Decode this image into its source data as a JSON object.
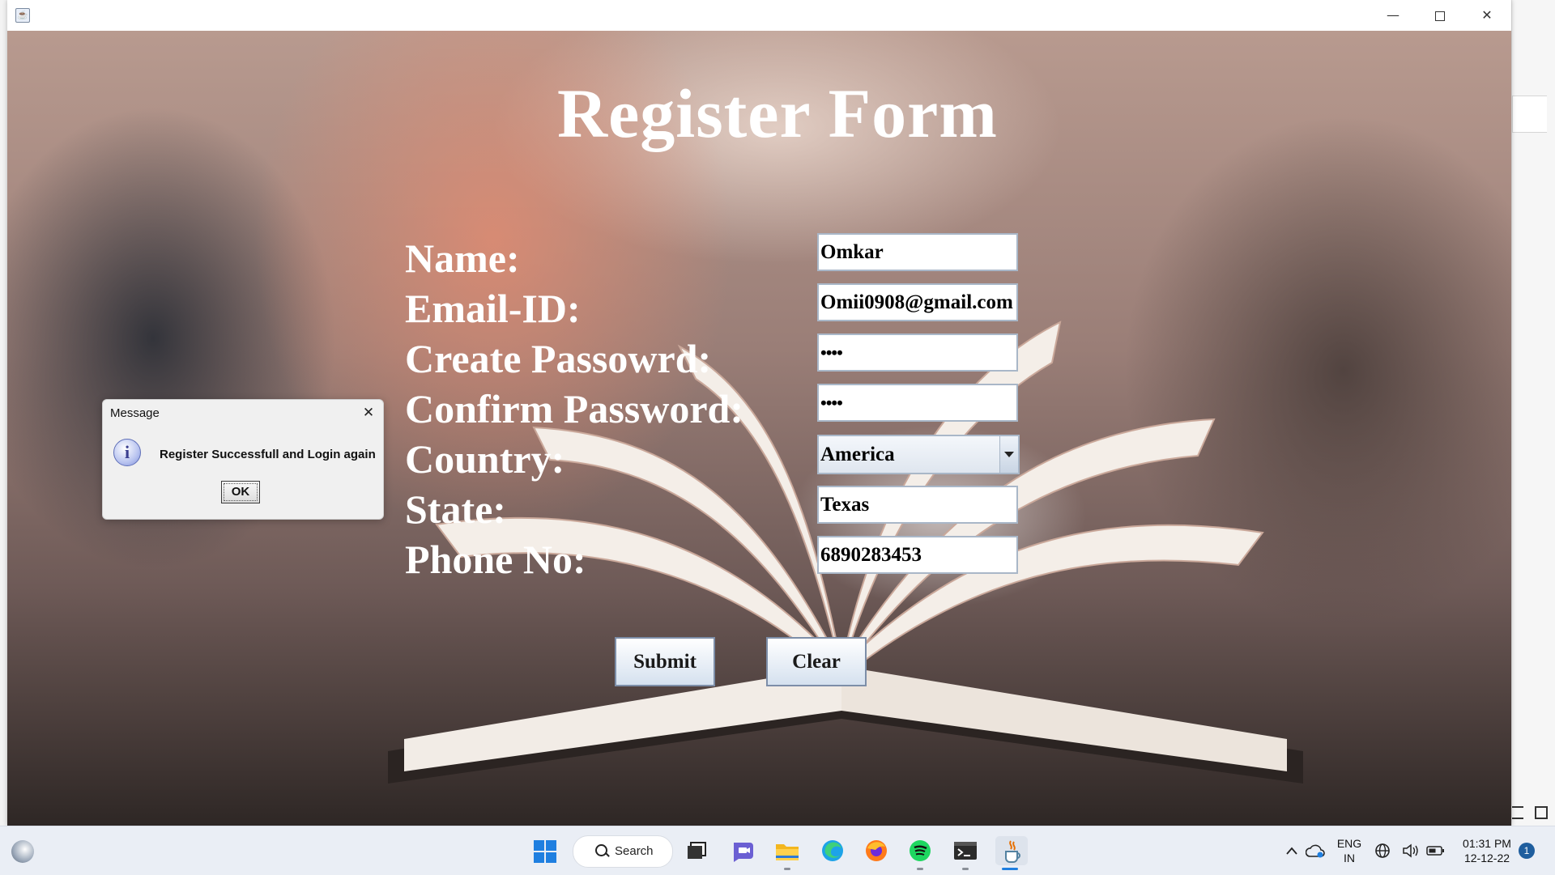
{
  "form": {
    "title": "Register Form",
    "labels": {
      "name": "Name:",
      "email": "Email-ID:",
      "create_password": "Create Passowrd:",
      "confirm_password": "Confirm Password:",
      "country": "Country:",
      "state": "State:",
      "phone": "Phone No:"
    },
    "values": {
      "name": "Omkar",
      "email": "Omii0908@gmail.com",
      "create_password": "••••",
      "confirm_password": "••••",
      "country": "America",
      "state": "Texas",
      "phone": "6890283453"
    },
    "buttons": {
      "submit": "Submit",
      "clear": "Clear"
    }
  },
  "dialog": {
    "title": "Message",
    "message": "Register Successfull and Login again",
    "ok": "OK"
  },
  "taskbar": {
    "search_label": "Search",
    "language": "ENG",
    "region": "IN",
    "time": "01:31 PM",
    "date": "12-12-22",
    "notification_count": "1"
  }
}
